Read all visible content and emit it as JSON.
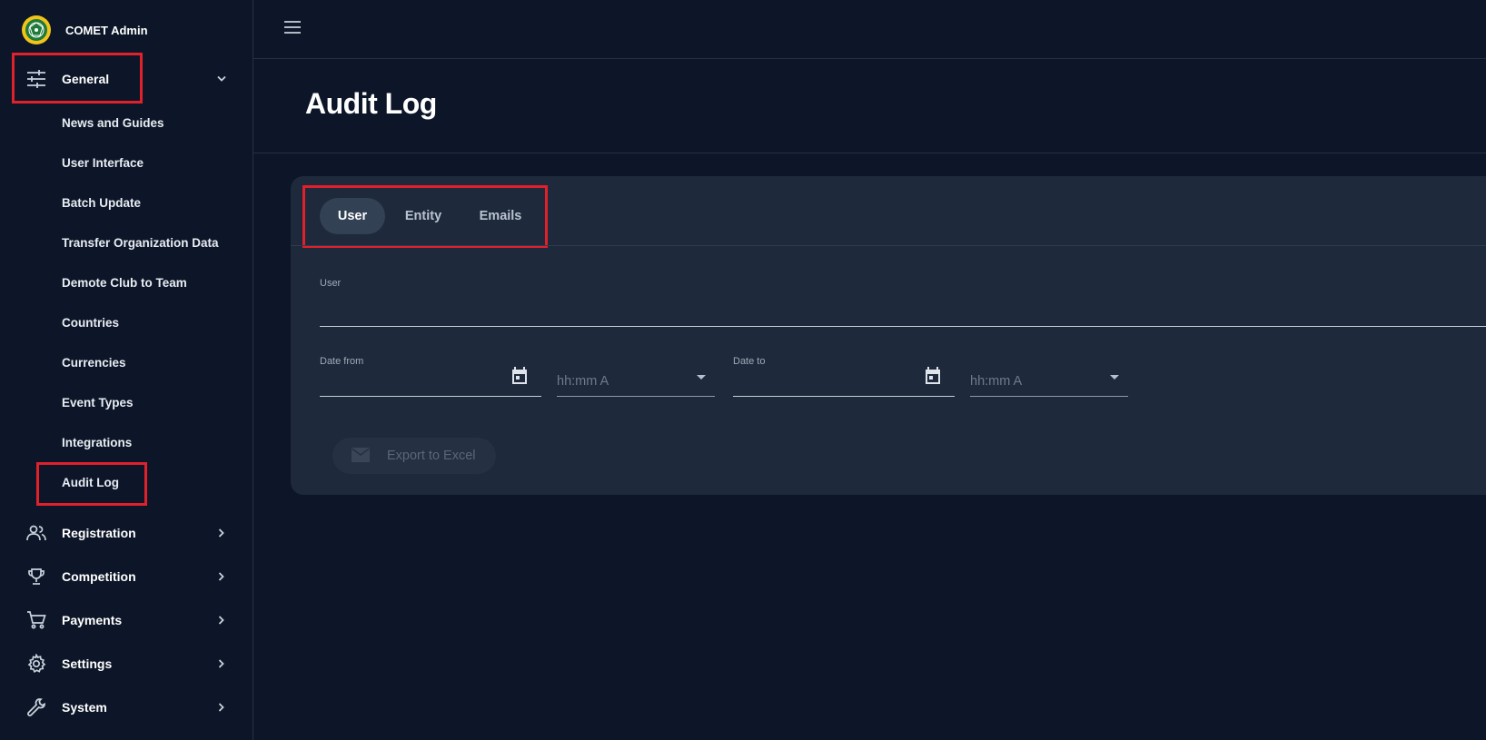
{
  "app": {
    "title": "COMET Admin"
  },
  "sidebar": {
    "general": {
      "label": "General",
      "icon": "tune-icon",
      "expanded": true,
      "children": [
        {
          "label": "News and Guides"
        },
        {
          "label": "User Interface"
        },
        {
          "label": "Batch Update"
        },
        {
          "label": "Transfer Organization Data"
        },
        {
          "label": "Demote Club to Team"
        },
        {
          "label": "Countries"
        },
        {
          "label": "Currencies"
        },
        {
          "label": "Event Types"
        },
        {
          "label": "Integrations"
        },
        {
          "label": "Audit Log",
          "active": true
        }
      ]
    },
    "sections": [
      {
        "label": "Registration",
        "icon": "people-icon"
      },
      {
        "label": "Competition",
        "icon": "trophy-icon"
      },
      {
        "label": "Payments",
        "icon": "cart-icon"
      },
      {
        "label": "Settings",
        "icon": "gear-icon"
      },
      {
        "label": "System",
        "icon": "wrench-icon"
      }
    ]
  },
  "page": {
    "title": "Audit Log"
  },
  "tabs": [
    {
      "label": "User",
      "active": true
    },
    {
      "label": "Entity",
      "active": false
    },
    {
      "label": "Emails",
      "active": false
    }
  ],
  "form": {
    "user_label": "User",
    "user_value": "",
    "date_from_label": "Date from",
    "date_from_value": "",
    "time_from_placeholder": "hh:mm A",
    "date_to_label": "Date to",
    "date_to_value": "",
    "time_to_placeholder": "hh:mm A"
  },
  "actions": {
    "export_label": "Export to Excel",
    "export_enabled": false
  },
  "colors": {
    "background": "#0d1628",
    "card": "#1e293b",
    "active_tab": "#334155",
    "highlight": "#e0202a",
    "logo": "#f1c419"
  }
}
